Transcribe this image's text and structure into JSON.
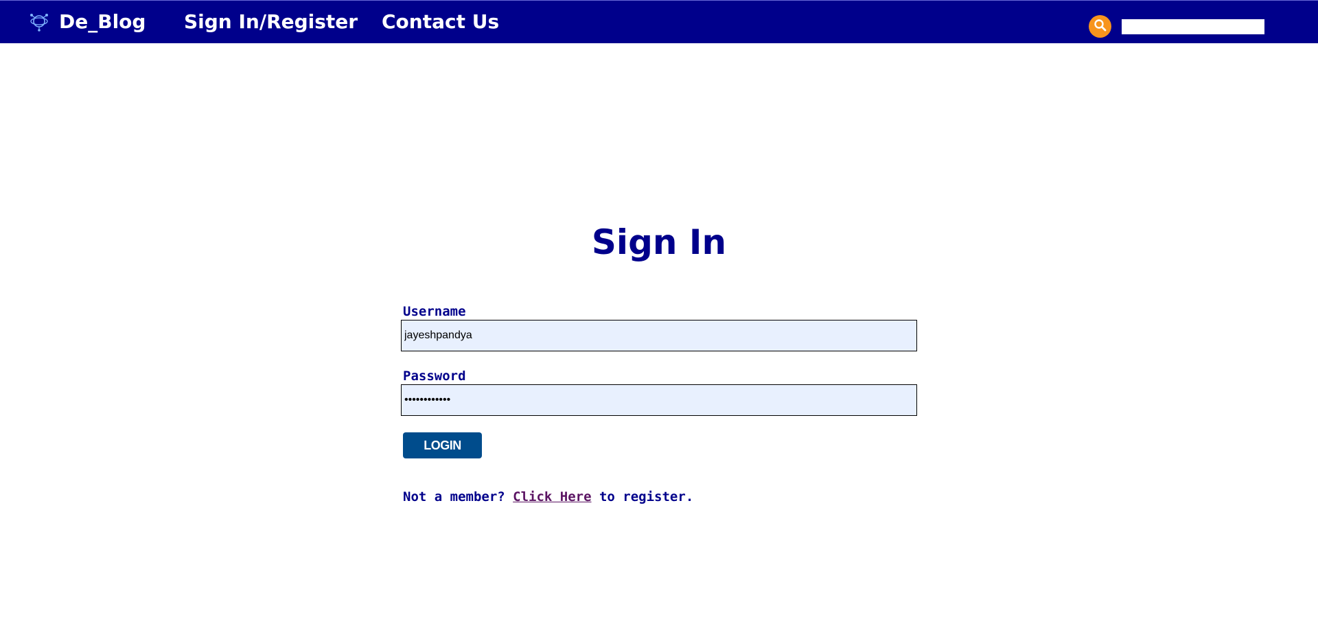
{
  "nav": {
    "brand": "De_Blog",
    "brand_icon": "network-globe-icon",
    "links": [
      {
        "label": "Sign In/Register"
      },
      {
        "label": "Contact Us"
      }
    ],
    "search_icon": "search-icon",
    "search_placeholder": "",
    "search_value": ""
  },
  "colors": {
    "navbar_bg": "#00008b",
    "accent": "#f7941d",
    "button_bg": "#004c8c",
    "text_primary": "#00008b",
    "input_bg": "#e8f0fe",
    "link_visited": "#5b1463"
  },
  "form": {
    "title": "Sign In",
    "username_label": "Username",
    "username_value": "jayeshpandya",
    "password_label": "Password",
    "password_value": "pandya123456",
    "login_label": "LOGIN",
    "register_prefix": "Not a member? ",
    "register_link": "Click Here",
    "register_suffix": " to register."
  }
}
